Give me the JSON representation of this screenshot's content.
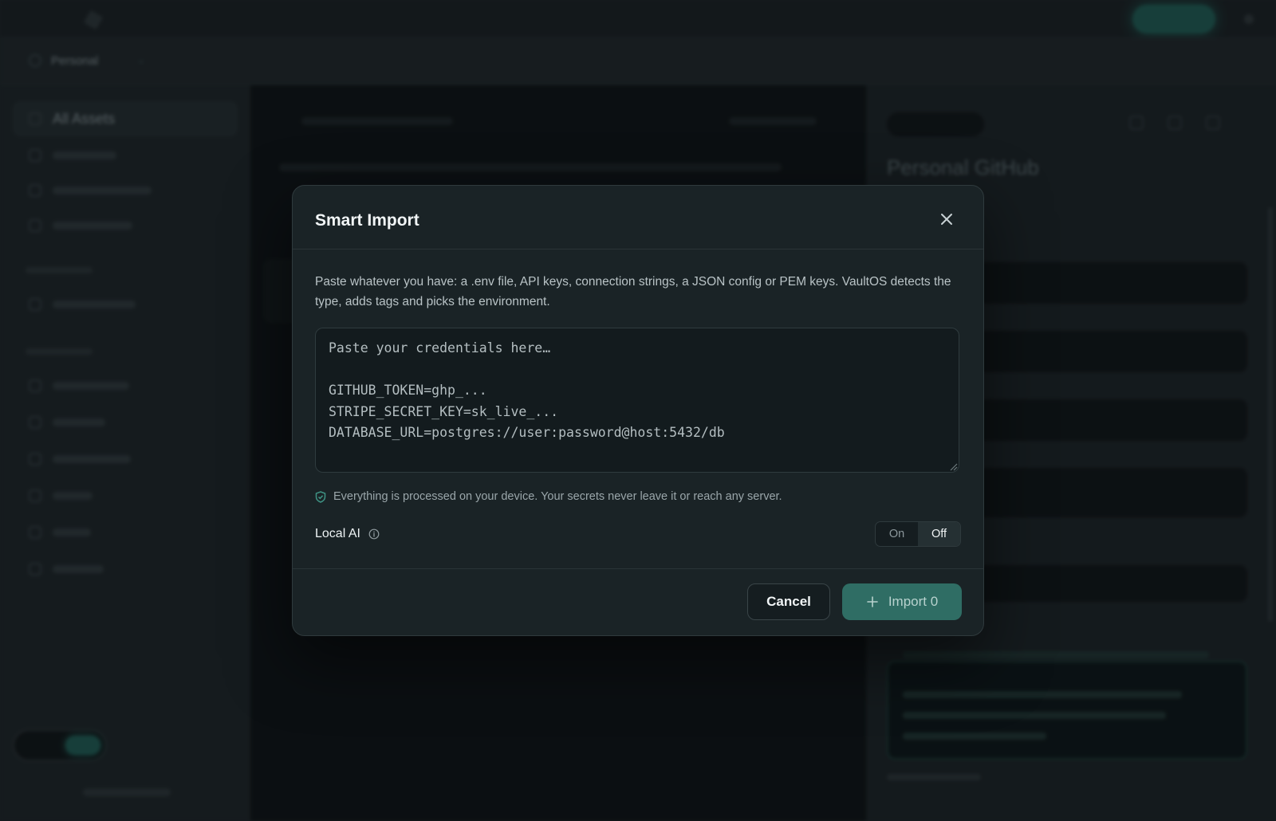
{
  "background": {
    "workspace_label": "Personal",
    "sidebar_active_label": "All Assets",
    "detail_title": "Personal GitHub"
  },
  "modal": {
    "title": "Smart Import",
    "description": "Paste whatever you have: a .env file, API keys, connection strings, a JSON config or PEM keys. VaultOS detects the type, adds tags and picks the environment.",
    "input": {
      "value": "",
      "placeholder": "Paste your credentials here…\n\nGITHUB_TOKEN=ghp_...\nSTRIPE_SECRET_KEY=sk_live_...\nDATABASE_URL=postgres://user:password@host:5432/db"
    },
    "privacy_note": "Everything is processed on your device. Your secrets never leave it or reach any server.",
    "local_ai": {
      "label": "Local AI",
      "options": [
        "On",
        "Off"
      ],
      "selected": "Off"
    },
    "buttons": {
      "cancel": "Cancel",
      "import": "Import 0"
    }
  },
  "colors": {
    "accent": "#2f6d64",
    "modal_bg": "#1a2326",
    "page_bg": "#1d2427"
  }
}
